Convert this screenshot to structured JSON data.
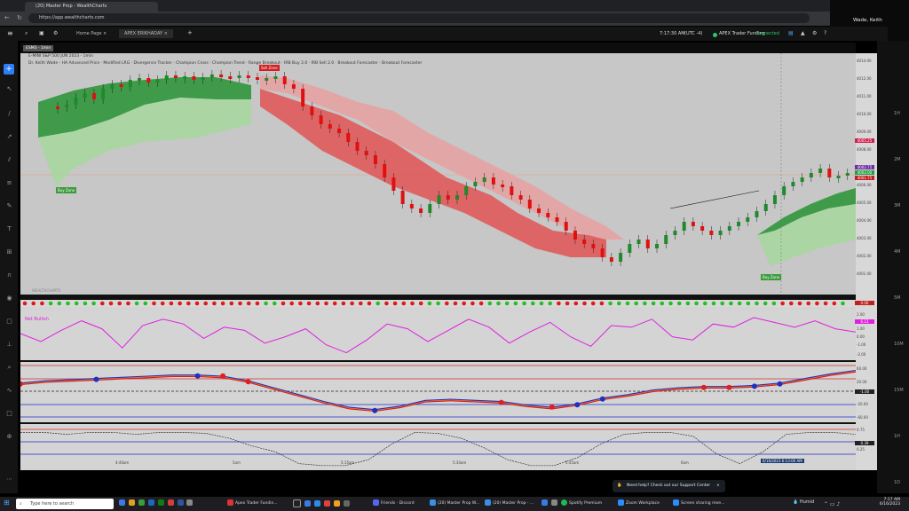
{
  "browser": {
    "tab_title": "(20) Master Prop - WealthCharts",
    "url": "https://app.wealthcharts.com"
  },
  "app": {
    "tabs": [
      {
        "label": "Home Page"
      },
      {
        "label": "APEX ERIKHADAY"
      }
    ],
    "time": "7:17:30 AM",
    "timezone": "(UTC -4)",
    "connection_label": "APEX Trader Funding",
    "connection_status": "Connected"
  },
  "user": {
    "name": "Wade, Keith"
  },
  "chart": {
    "symbol_badge": "ESM3 - 1min",
    "title": "E-MINI S&P 500 JUN 2023 - 1min",
    "indicators": [
      "Dr. Keith Wade - HA Advanced Price",
      "Modified LRG",
      "Divergence Tracker",
      "Champion Cross",
      "Champion Trend",
      "Range Breakout",
      "IRB Buy 2.0",
      "IRB Sell 2.0",
      "Breakout Forecaster",
      "Breakout Forecaster"
    ],
    "price_labels": [
      "4014.00",
      "4012.00",
      "4011.00",
      "4010.00",
      "4009.00",
      "4008.00",
      "4007.00",
      "4006.00",
      "4005.00",
      "4004.00",
      "4003.00",
      "4002.00",
      "4001.00"
    ],
    "price_tags": [
      {
        "text": "4005.25",
        "color": "#d02050"
      },
      {
        "text": "4002.75",
        "color": "#7030a0"
      },
      {
        "text": "4002.00",
        "color": "#20a040"
      },
      {
        "text": "4001.75",
        "color": "#c02020"
      }
    ],
    "signals": [
      {
        "text": "Sell Zone"
      },
      {
        "text": "Buy Zone"
      },
      {
        "text": "Buy Zone"
      }
    ],
    "time_labels": [
      "4:40am",
      "5am",
      "5:15am",
      "5:30am",
      "5:45am",
      "6am"
    ],
    "cursor_time": "6/16/2023 6:13:00 AM",
    "watermark": "WEALTHCHARTS",
    "panels": [
      {
        "name": "Net Bullish",
        "last": "6.13",
        "labels": [
          "2.00",
          "1.00",
          "0.00",
          "-1.00",
          "-2.00"
        ]
      },
      {
        "name": "",
        "last": "-1.00",
        "labels": [
          "60.00",
          "20.00",
          "-20.00",
          "-60.00"
        ]
      },
      {
        "name": "",
        "last": "0.39",
        "labels": [
          "0.75",
          "0.50",
          "0.25"
        ]
      }
    ],
    "panel0_tag": "0.00",
    "right_col_labels": [
      "1H",
      "2M",
      "3M",
      "4M",
      "5M",
      "10M",
      "15M",
      "1H",
      "1D"
    ]
  },
  "support_popup": {
    "text": "Need help? Check out our Support Center"
  },
  "taskbar": {
    "search_placeholder": "Type here to search",
    "items": [
      {
        "label": "Apex Trader Fundin...",
        "color": "#d33"
      },
      {
        "label": "Friends - Discord",
        "color": "#5865f2"
      },
      {
        "label": "(20) Master Prop W...",
        "color": "#3a8ee6"
      },
      {
        "label": "(20) Master Prop - ...",
        "color": "#3a8ee6"
      },
      {
        "label": "Spotify Premium",
        "color": "#1db954"
      },
      {
        "label": "Zoom Workplace",
        "color": "#2d8cff"
      },
      {
        "label": "Screen sharing mee...",
        "color": "#2d8cff"
      }
    ],
    "weather": "Humid",
    "clock_time": "7:17 AM",
    "clock_date": "6/16/2023"
  }
}
